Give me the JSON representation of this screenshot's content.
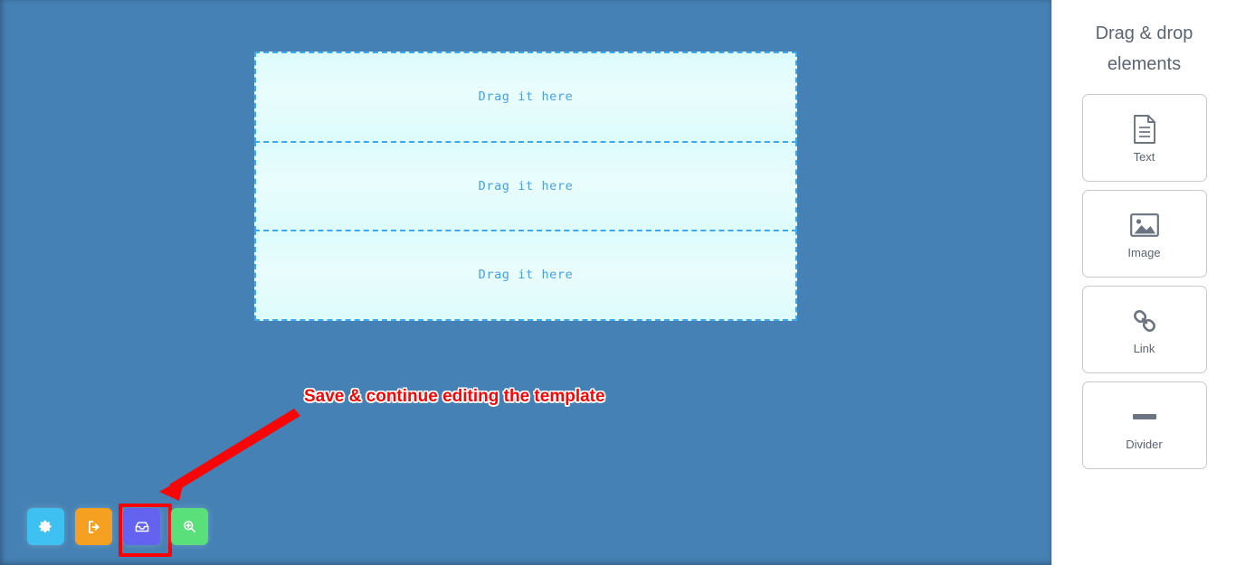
{
  "canvas": {
    "background_color": "#4581b4",
    "dropzones": [
      {
        "label": "Drag it here"
      },
      {
        "label": "Drag it here"
      },
      {
        "label": "Drag it here"
      }
    ]
  },
  "annotation": {
    "caption": "Save & continue editing the template",
    "text_color": "#f60606",
    "outline_color": "#ffffff",
    "arrow_color": "#f60606",
    "arrow_points_to": "save-template-button"
  },
  "toolbar": {
    "buttons": [
      {
        "name": "settings-button",
        "icon": "gear-icon",
        "label": "Settings",
        "color": "#3ec0f0",
        "highlighted": false
      },
      {
        "name": "exit-button",
        "icon": "exit-arrow-icon",
        "label": "Exit",
        "color": "#f5a021",
        "highlighted": false
      },
      {
        "name": "save-template-button",
        "icon": "save-box-icon",
        "label": "Save & continue editing the template",
        "color": "#6363ef",
        "highlighted": true
      },
      {
        "name": "preview-button",
        "icon": "zoom-in-icon",
        "label": "Preview",
        "color": "#5ae07a",
        "highlighted": false
      }
    ],
    "highlight_color": "#fb0005"
  },
  "sidebar": {
    "title": "Drag & drop elements",
    "elements": [
      {
        "label": "Text",
        "icon": "document-icon"
      },
      {
        "label": "Image",
        "icon": "picture-icon"
      },
      {
        "label": "Link",
        "icon": "chain-link-icon"
      },
      {
        "label": "Divider",
        "icon": "horizontal-rule-icon"
      }
    ]
  }
}
